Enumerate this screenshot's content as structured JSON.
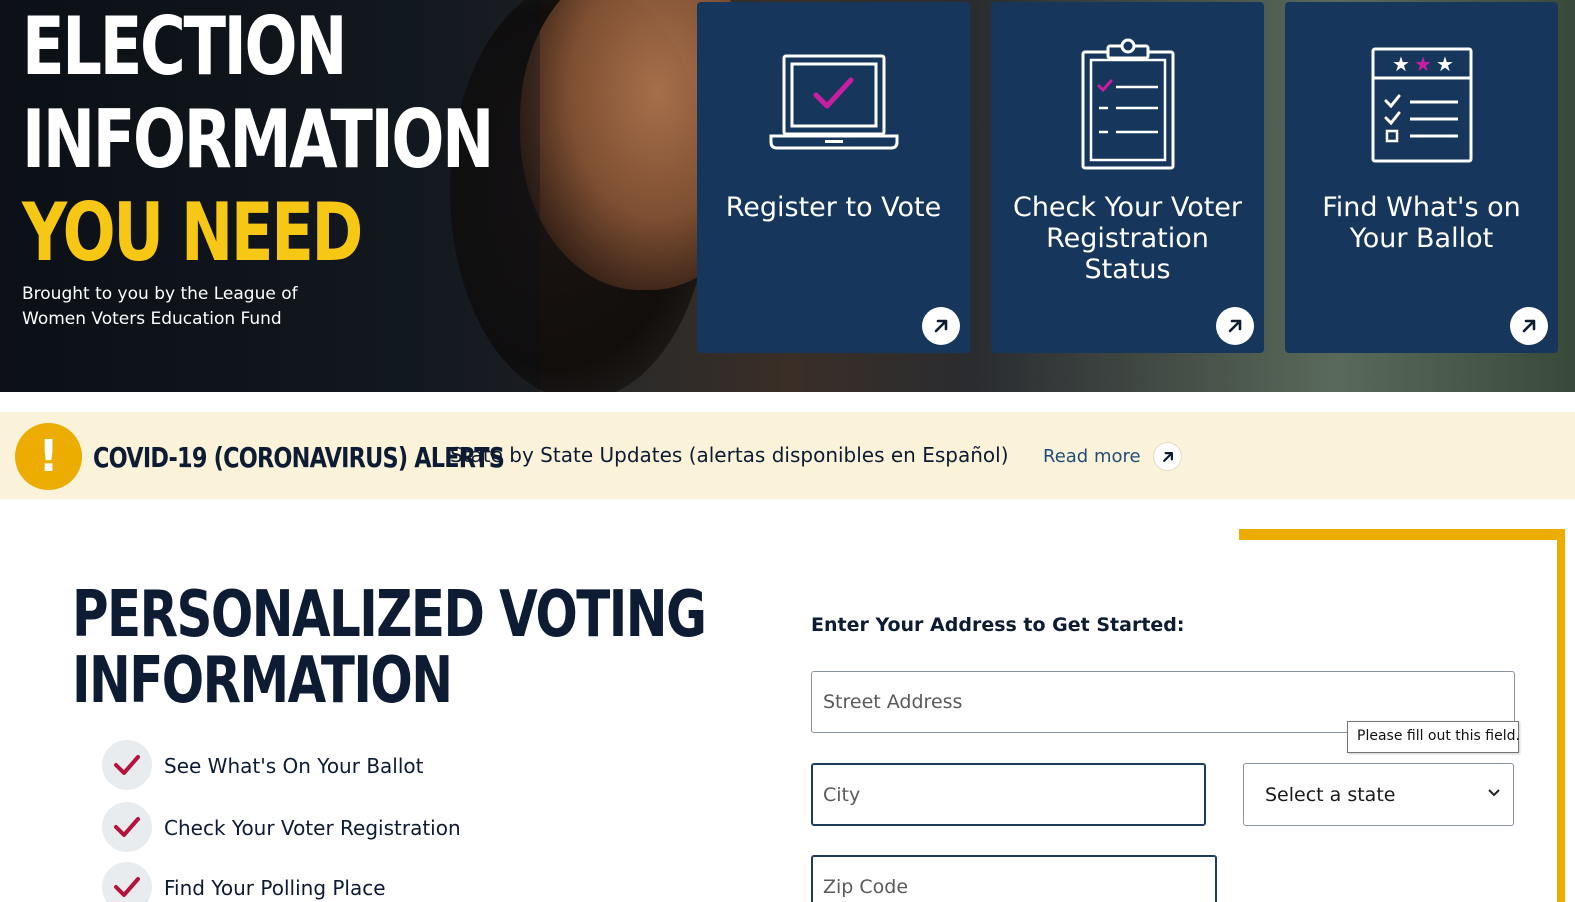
{
  "hero": {
    "title_line1": "ELECTION",
    "title_line2": "INFORMATION",
    "title_line3": "YOU NEED",
    "subtitle": "Brought to you by the League of Women Voters Education Fund",
    "cards": [
      {
        "label": "Register to Vote",
        "icon": "laptop-check-icon"
      },
      {
        "label": "Check Your Voter Registration Status",
        "icon": "clipboard-checklist-icon"
      },
      {
        "label": "Find What's on Your Ballot",
        "icon": "ballot-stars-icon"
      }
    ]
  },
  "alert": {
    "icon": "exclamation-icon",
    "title": "COVID-19 (CORONAVIRUS) ALERTS",
    "text": "State by State Updates (alertas disponibles en Español)",
    "link": "Read more"
  },
  "main": {
    "title_line1": "PERSONALIZED VOTING",
    "title_line2": "INFORMATION",
    "checklist": [
      "See What's On Your Ballot",
      "Check Your Voter Registration",
      "Find Your Polling Place"
    ]
  },
  "form": {
    "heading": "Enter Your Address to Get Started:",
    "street_placeholder": "Street Address",
    "city_placeholder": "City",
    "state_selected": "Select a state",
    "zip_placeholder": "Zip Code",
    "tooltip": "Please fill out this field."
  },
  "colors": {
    "navy": "#16365c",
    "yellow": "#f7c716",
    "accent_gold": "#edac00",
    "alert_bg": "#fbf3d9",
    "check_red": "#b5123e",
    "magenta": "#c81fa0"
  }
}
